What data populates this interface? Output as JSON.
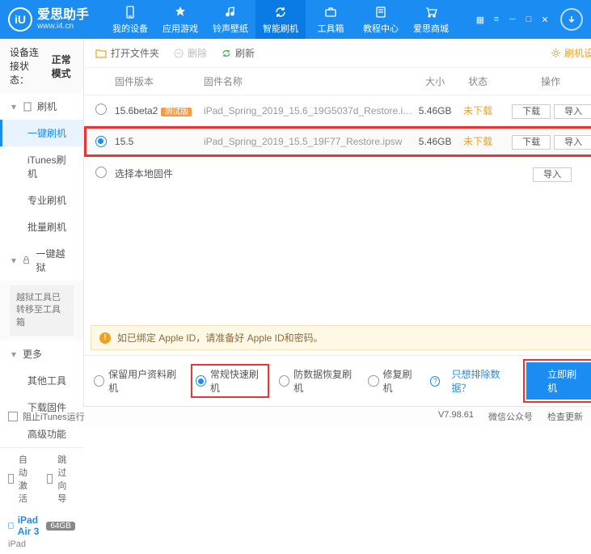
{
  "brand": {
    "name": "爱思助手",
    "site": "www.i4.cn",
    "logo_letter": "iU"
  },
  "nav": {
    "items": [
      {
        "label": "我的设备"
      },
      {
        "label": "应用游戏"
      },
      {
        "label": "铃声壁纸"
      },
      {
        "label": "智能刷机"
      },
      {
        "label": "工具箱"
      },
      {
        "label": "教程中心"
      },
      {
        "label": "爱思商城"
      }
    ],
    "active_index": 3
  },
  "sidebar": {
    "status_label": "设备连接状态：",
    "status_value": "正常模式",
    "sections": [
      {
        "title": "刷机",
        "items": [
          "一键刷机",
          "iTunes刷机",
          "专业刷机",
          "批量刷机"
        ],
        "active_index": 0
      },
      {
        "title": "一键越狱",
        "note": "越狱工具已转移至工具箱"
      },
      {
        "title": "更多",
        "items": [
          "其他工具",
          "下载固件",
          "高级功能"
        ]
      }
    ],
    "auto_activate": "自动激活",
    "skip_guide": "跳过向导",
    "device": {
      "name": "iPad Air 3",
      "storage": "64GB",
      "model": "iPad"
    }
  },
  "toolbar": {
    "open_folder": "打开文件夹",
    "delete": "删除",
    "refresh": "刷新",
    "fw_settings": "刷机设置"
  },
  "table": {
    "headers": {
      "version": "固件版本",
      "name": "固件名称",
      "size": "大小",
      "state": "状态",
      "ops": "操作"
    },
    "rows": [
      {
        "version": "15.6beta2",
        "beta_tag": "测试版",
        "name": "iPad_Spring_2019_15.6_19G5037d_Restore.i…",
        "size": "5.46GB",
        "state": "未下载",
        "selected": false,
        "highlight": false
      },
      {
        "version": "15.5",
        "beta_tag": "",
        "name": "iPad_Spring_2019_15.5_19F77_Restore.ipsw",
        "size": "5.46GB",
        "state": "未下载",
        "selected": true,
        "highlight": true
      }
    ],
    "btn_download": "下载",
    "btn_import": "导入",
    "local_fw": "选择本地固件"
  },
  "warning": {
    "text": "如已绑定 Apple ID，请准备好 Apple ID和密码。"
  },
  "modes": {
    "opts": [
      "保留用户资料刷机",
      "常规快速刷机",
      "防数据恢复刷机",
      "修复刷机"
    ],
    "selected_index": 1,
    "exclude_link": "只想排除数据？",
    "flash_btn": "立即刷机"
  },
  "statusbar": {
    "block_itunes": "阻止iTunes运行",
    "version": "V7.98.61",
    "wechat": "微信公众号",
    "check_update": "检查更新"
  }
}
